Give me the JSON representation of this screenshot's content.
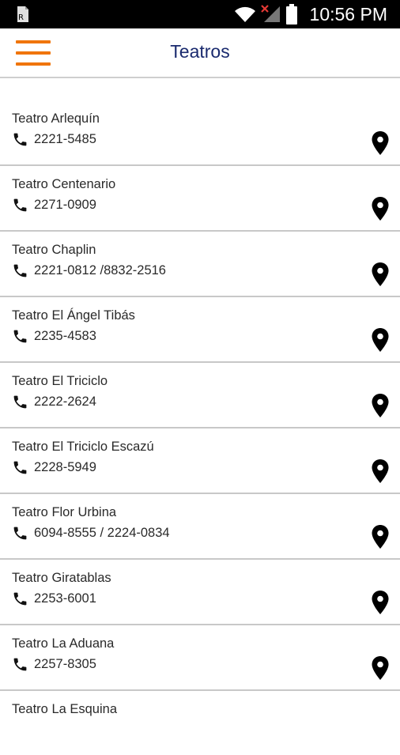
{
  "status_bar": {
    "time": "10:56 PM"
  },
  "app_bar": {
    "title": "Teatros",
    "menu_color": "#f0750a",
    "title_color": "#1a2a6e"
  },
  "theaters": [
    {
      "name": "Teatro Arlequín",
      "phone": "2221-5485"
    },
    {
      "name": "Teatro Centenario",
      "phone": "2271-0909"
    },
    {
      "name": "Teatro Chaplin",
      "phone": "2221-0812 /8832-2516"
    },
    {
      "name": "Teatro El Ángel Tibás",
      "phone": "2235-4583"
    },
    {
      "name": "Teatro El Triciclo",
      "phone": "2222-2624"
    },
    {
      "name": "Teatro El Triciclo Escazú",
      "phone": "2228-5949"
    },
    {
      "name": "Teatro Flor Urbina",
      "phone": "6094-8555 / 2224-0834"
    },
    {
      "name": "Teatro Giratablas",
      "phone": "2253-6001"
    },
    {
      "name": "Teatro La Aduana",
      "phone": "2257-8305"
    },
    {
      "name": "Teatro La Esquina"
    }
  ],
  "icons": {
    "phone": "phone-icon",
    "location": "map-pin-icon",
    "menu": "hamburger-menu-icon"
  }
}
